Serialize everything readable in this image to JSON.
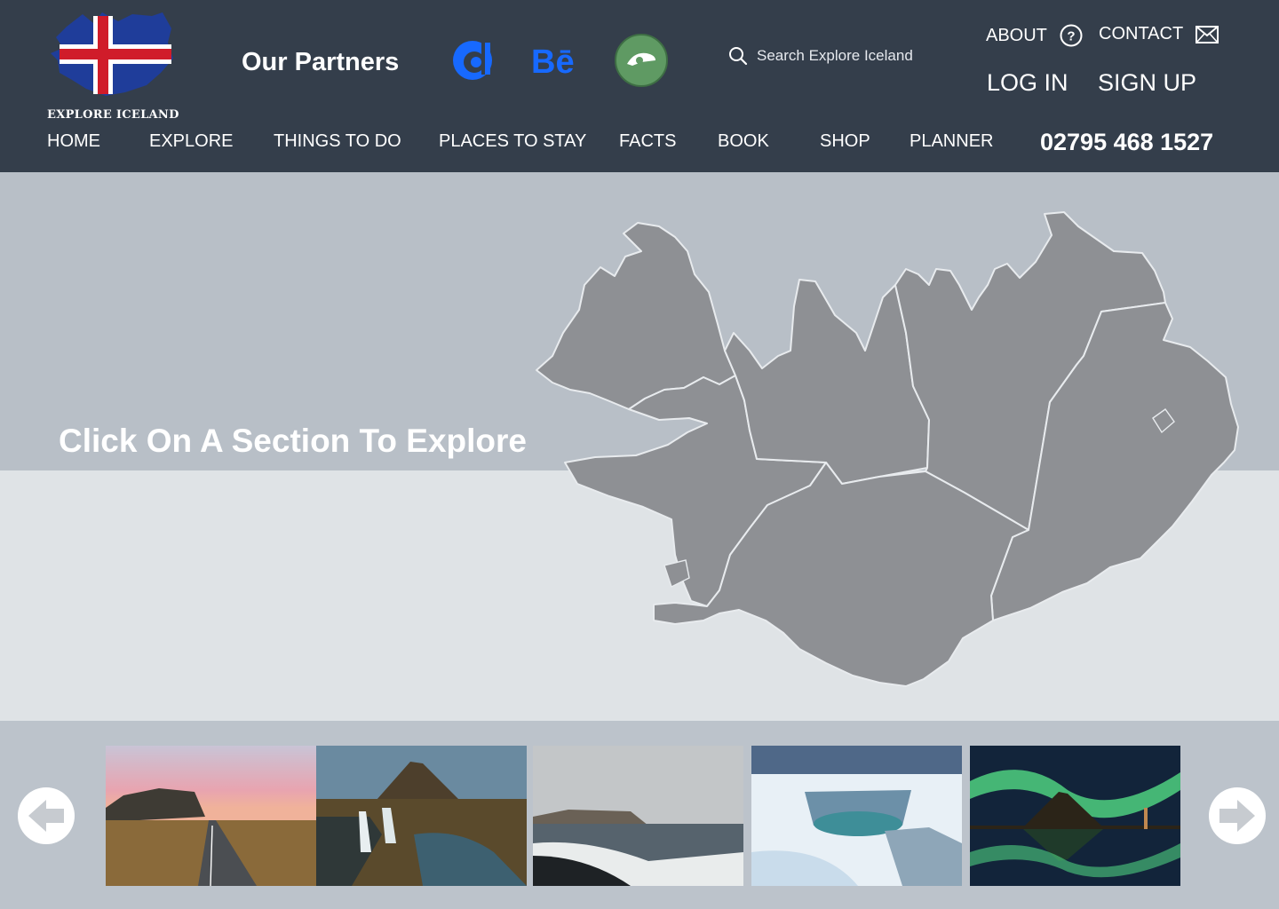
{
  "header": {
    "logo_text": "EXPLORE ICELAND",
    "partners_title": "Our Partners",
    "partner_icons": [
      "dailymotion-icon",
      "behance-icon",
      "deviantart-icon"
    ],
    "search": {
      "placeholder": "Search Explore Iceland",
      "icon": "search-icon"
    },
    "about_label": "ABOUT",
    "contact_label": "CONTACT",
    "login_label": "LOG IN",
    "signup_label": "SIGN UP",
    "phone": "02795 468 1527"
  },
  "nav": {
    "items": [
      {
        "label": "HOME"
      },
      {
        "label": "EXPLORE"
      },
      {
        "label": "THINGS TO DO"
      },
      {
        "label": "PLACES TO STAY"
      },
      {
        "label": "FACTS"
      },
      {
        "label": "BOOK"
      },
      {
        "label": "SHOP"
      },
      {
        "label": "PLANNER"
      }
    ]
  },
  "hero": {
    "prompt": "Click On A Section To Explore"
  },
  "carousel": {
    "prev_icon": "arrow-left-icon",
    "next_icon": "arrow-right-icon",
    "images": [
      "road-sunset",
      "kirkjufell-waterfall",
      "black-sand-beach",
      "frozen-waterfall",
      "northern-lights"
    ]
  },
  "colors": {
    "header_bg": "#343e4b",
    "hero_top": "#b8bfc7",
    "hero_bottom": "#dfe3e6",
    "map_fill": "#8e9094",
    "accent_blue": "#1769ff"
  }
}
